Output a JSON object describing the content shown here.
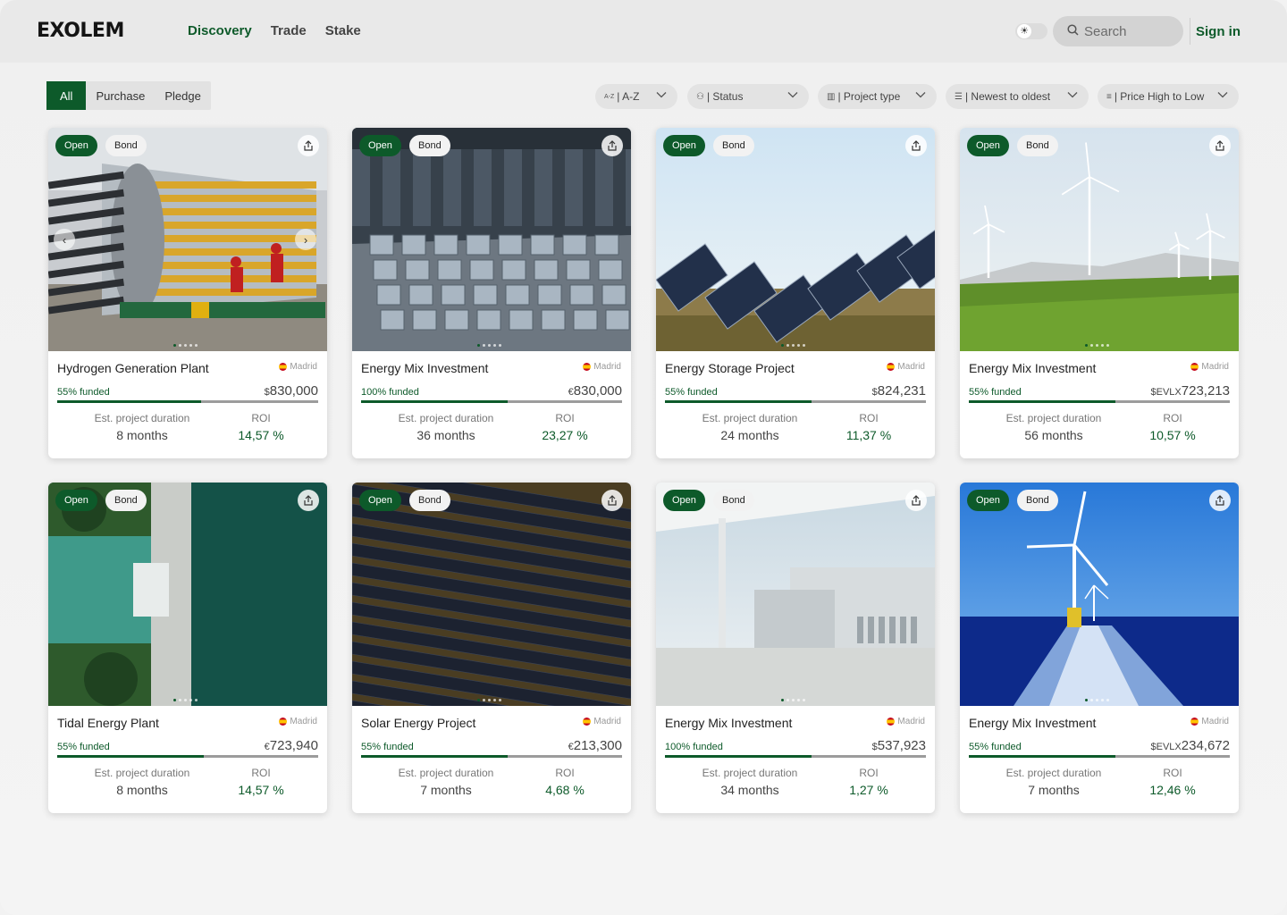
{
  "brand": "EXOLEM",
  "nav": [
    {
      "label": "Discovery",
      "active": true
    },
    {
      "label": "Trade",
      "active": false
    },
    {
      "label": "Stake",
      "active": false
    }
  ],
  "header": {
    "theme_icon": "sun-icon",
    "search_placeholder": "Search",
    "signin_label": "Sign in"
  },
  "segments": [
    {
      "label": "All",
      "active": true
    },
    {
      "label": "Purchase",
      "active": false
    },
    {
      "label": "Pledge",
      "active": false
    }
  ],
  "filters": [
    {
      "label": "A-Z",
      "icon": "az-sort-icon",
      "icon_text": "A-Z"
    },
    {
      "label": "Status",
      "icon": "status-icon",
      "icon_text": "⚇"
    },
    {
      "label": "Project type",
      "icon": "building-icon",
      "icon_text": "▥"
    },
    {
      "label": "Newest to oldest",
      "icon": "sort-lines-icon",
      "icon_text": "☰"
    },
    {
      "label": "Price High to Low",
      "icon": "price-sort-icon",
      "icon_text": "≡"
    }
  ],
  "colors": {
    "brand_green": "#0d5a2a",
    "bar_gray": "#9c9c9c"
  },
  "labels": {
    "open": "Open",
    "bond": "Bond",
    "duration": "Est. project duration",
    "roi": "ROI"
  },
  "projects": [
    {
      "title": "Hydrogen Generation Plant",
      "location": "Madrid",
      "funded_label": "55% funded",
      "funded_fraction": 0.55,
      "currency": "$",
      "amount": "830,000",
      "duration": "8 months",
      "roi": "14,57 %",
      "image": "hydrogen-plant"
    },
    {
      "title": "Energy Mix Investment",
      "location": "Madrid",
      "funded_label": "100% funded",
      "funded_fraction": 0.56,
      "currency": "€",
      "amount": "830,000",
      "duration": "36 months",
      "roi": "23,27 %",
      "image": "battery-warehouse"
    },
    {
      "title": "Energy Storage Project",
      "location": "Madrid",
      "funded_label": "55% funded",
      "funded_fraction": 0.56,
      "currency": "$",
      "amount": "824,231",
      "duration": "24 months",
      "roi": "11,37 %",
      "image": "solar-field"
    },
    {
      "title": "Energy Mix Investment",
      "location": "Madrid",
      "funded_label": "55% funded",
      "funded_fraction": 0.56,
      "currency": "$EVLX",
      "amount": "723,213",
      "duration": "56 months",
      "roi": "10,57 %",
      "image": "wind-farm"
    },
    {
      "title": "Tidal Energy Plant",
      "location": "Madrid",
      "funded_label": "55% funded",
      "funded_fraction": 0.56,
      "currency": "€",
      "amount": "723,940",
      "duration": "8 months",
      "roi": "14,57 %",
      "image": "tidal-dam"
    },
    {
      "title": "Solar Energy Project",
      "location": "Madrid",
      "funded_label": "55% funded",
      "funded_fraction": 0.56,
      "currency": "€",
      "amount": "213,300",
      "duration": "7 months",
      "roi": "4,68 %",
      "image": "solar-rows"
    },
    {
      "title": "Energy Mix Investment",
      "location": "Madrid",
      "funded_label": "100% funded",
      "funded_fraction": 0.56,
      "currency": "$",
      "amount": "537,923",
      "duration": "34 months",
      "roi": "1,27 %",
      "image": "white-building"
    },
    {
      "title": "Energy Mix Investment",
      "location": "Madrid",
      "funded_label": "55% funded",
      "funded_fraction": 0.56,
      "currency": "$EVLX",
      "amount": "234,672",
      "duration": "7 months",
      "roi": "12,46 %",
      "image": "offshore-wind"
    }
  ]
}
